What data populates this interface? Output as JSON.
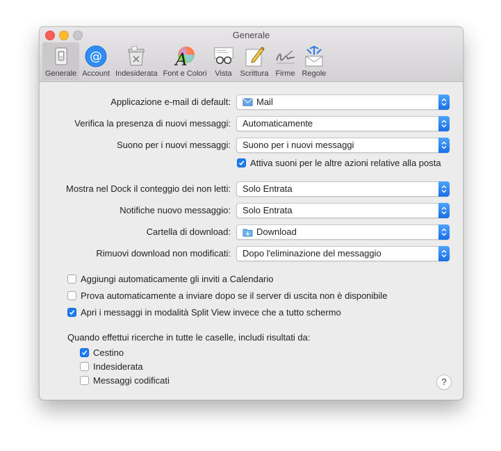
{
  "window": {
    "title": "Generale"
  },
  "tabs": [
    {
      "label": "Generale",
      "icon": "switch-icon",
      "selected": true
    },
    {
      "label": "Account",
      "icon": "at-sign-icon",
      "selected": false
    },
    {
      "label": "Indesiderata",
      "icon": "junk-bin-icon",
      "selected": false
    },
    {
      "label": "Font e Colori",
      "icon": "font-colors-icon",
      "selected": false
    },
    {
      "label": "Vista",
      "icon": "glasses-icon",
      "selected": false
    },
    {
      "label": "Scrittura",
      "icon": "pencil-paper-icon",
      "selected": false
    },
    {
      "label": "Firme",
      "icon": "signature-icon",
      "selected": false
    },
    {
      "label": "Regole",
      "icon": "rules-icon",
      "selected": false
    }
  ],
  "settings": {
    "default_app": {
      "label": "Applicazione e-mail di default:",
      "value": "Mail"
    },
    "check_new": {
      "label": "Verifica la presenza di nuovi messaggi:",
      "value": "Automaticamente"
    },
    "new_sound": {
      "label": "Suono per i nuovi messaggi:",
      "value": "Suono per i nuovi messaggi"
    },
    "other_sounds": {
      "label": "Attiva suoni per le altre azioni relative alla posta",
      "checked": true
    },
    "dock_count": {
      "label": "Mostra nel Dock il conteggio dei non letti:",
      "value": "Solo Entrata"
    },
    "notifications": {
      "label": "Notifiche nuovo messaggio:",
      "value": "Solo Entrata"
    },
    "download_folder": {
      "label": "Cartella di download:",
      "value": "Download"
    },
    "remove_downloads": {
      "label": "Rimuovi download non modificati:",
      "value": "Dopo l'eliminazione del messaggio"
    },
    "add_invites": {
      "label": "Aggiungi automaticamente gli inviti a Calendario",
      "checked": false
    },
    "retry_send": {
      "label": "Prova automaticamente a inviare dopo se il server di uscita non è disponibile",
      "checked": false
    },
    "split_view": {
      "label": "Apri i messaggi in modalità Split View invece che a tutto schermo",
      "checked": true
    },
    "search_intro": "Quando effettui ricerche in tutte le caselle, includi risultati da:",
    "search_trash": {
      "label": "Cestino",
      "checked": true
    },
    "search_junk": {
      "label": "Indesiderata",
      "checked": false
    },
    "search_encrypted": {
      "label": "Messaggi codificati",
      "checked": false
    }
  },
  "help": {
    "label": "?"
  },
  "colors": {
    "accent": "#1c7cf4",
    "close": "#fc5f57",
    "minimize": "#fdbc2e"
  }
}
